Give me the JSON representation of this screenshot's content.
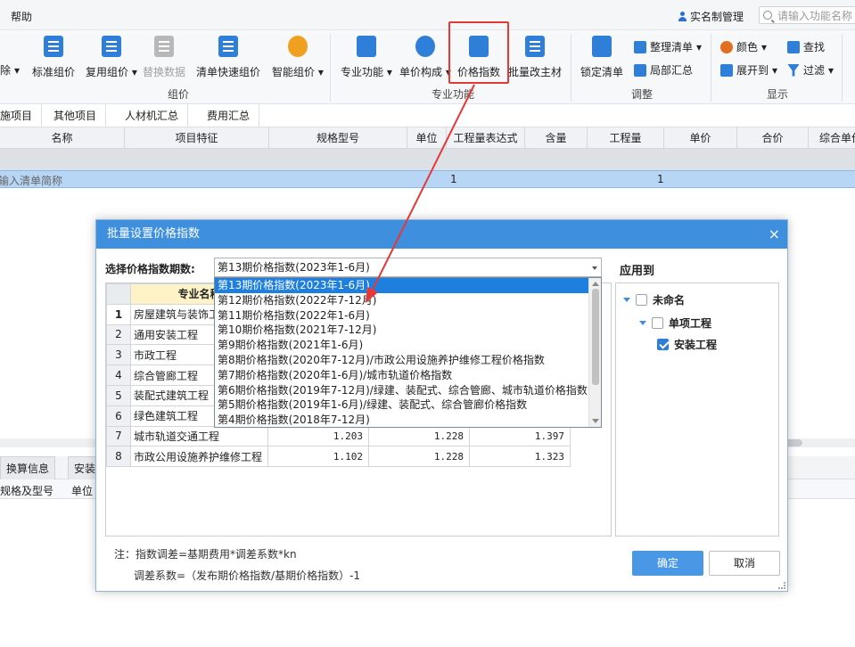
{
  "menubar": {
    "help": "帮助",
    "realname": "实名制管理",
    "search_placeholder": "请输入功能名称"
  },
  "ribbon": {
    "left_cut": "除",
    "buttons": [
      {
        "id": "standard",
        "label": "标准组价",
        "color": "#2f7fd8"
      },
      {
        "id": "reuse",
        "label": "复用组价",
        "color": "#2f7fd8"
      },
      {
        "id": "replace",
        "label": "替换数据",
        "color": "#b0b0b0"
      },
      {
        "id": "quick",
        "label": "清单快速组价",
        "color": "#2f7fd8"
      },
      {
        "id": "smart",
        "label": "智能组价",
        "color": "#f0a020"
      },
      {
        "id": "specialty",
        "label": "专业功能",
        "color": "#2f7fd8"
      },
      {
        "id": "unitprice",
        "label": "单价构成",
        "color": "#2f7fd8"
      },
      {
        "id": "priceindex",
        "label": "价格指数",
        "color": "#2f7fd8"
      },
      {
        "id": "batch",
        "label": "批量改主材",
        "color": "#2f7fd8"
      },
      {
        "id": "lock",
        "label": "锁定清单",
        "color": "#2f7fd8"
      }
    ],
    "small": {
      "organize": "整理清单",
      "local_summary": "局部汇总",
      "color": "颜色",
      "expand": "展开到",
      "find": "查找",
      "filter": "过滤"
    },
    "groups": {
      "pricing": "组价",
      "specialty": "专业功能",
      "adjust": "调整",
      "display": "显示"
    }
  },
  "tabs": [
    "施项目",
    "其他项目",
    "人材机汇总",
    "费用汇总"
  ],
  "grid": {
    "headers": [
      "名称",
      "项目特征",
      "规格型号",
      "单位",
      "工程量表达式",
      "含量",
      "工程量",
      "单价",
      "合价",
      "综合单价"
    ],
    "row": {
      "name": "输入清单简称",
      "expr": "1",
      "qty": "1"
    }
  },
  "bottom": {
    "tabs": [
      "换算信息",
      "安装"
    ],
    "headers": [
      "规格及型号",
      "单位"
    ]
  },
  "dialog": {
    "title": "批量设置价格指数",
    "close": "×",
    "period_label": "选择价格指数期数:",
    "period_selected": "第13期价格指数(2023年1-6月)",
    "period_options": [
      "第13期价格指数(2023年1-6月)",
      "第12期价格指数(2022年7-12月)",
      "第11期价格指数(2022年1-6月)",
      "第10期价格指数(2021年7-12月)",
      "第9期价格指数(2021年1-6月)",
      "第8期价格指数(2020年7-12月)/市政公用设施养护维修工程价格指数",
      "第7期价格指数(2020年1-6月)/城市轨道价格指数",
      "第6期价格指数(2019年7-12月)/绿建、装配式、综合管廊、城市轨道价格指数",
      "第5期价格指数(2019年1-6月)/绿建、装配式、综合管廊价格指数",
      "第4期价格指数(2018年7-12月)"
    ],
    "table": {
      "header": "专业名称",
      "rows": [
        {
          "no": "1",
          "name": "房屋建筑与装饰工程",
          "v1": "",
          "v2": "",
          "v3": ""
        },
        {
          "no": "2",
          "name": "通用安装工程",
          "v1": "",
          "v2": "",
          "v3": ""
        },
        {
          "no": "3",
          "name": "市政工程",
          "v1": "",
          "v2": "",
          "v3": ""
        },
        {
          "no": "4",
          "name": "综合管廊工程",
          "v1": "",
          "v2": "",
          "v3": ""
        },
        {
          "no": "5",
          "name": "装配式建筑工程",
          "v1": "",
          "v2": "",
          "v3": ""
        },
        {
          "no": "6",
          "name": "绿色建筑工程",
          "v1": "",
          "v2": "",
          "v3": ""
        },
        {
          "no": "7",
          "name": "城市轨道交通工程",
          "v1": "1.203",
          "v2": "1.228",
          "v3": "1.397"
        },
        {
          "no": "8",
          "name": "市政公用设施养护维修工程",
          "v1": "1.102",
          "v2": "1.228",
          "v3": "1.323"
        }
      ]
    },
    "apply": {
      "label": "应用到",
      "root": "未命名",
      "child": "单项工程",
      "leaf": "安装工程",
      "root_checked": false,
      "child_checked": false,
      "leaf_checked": true
    },
    "note1": "注：指数调差=基期费用*调差系数*kn",
    "note2": "调差系数=（发布期价格指数/基期价格指数）-1",
    "ok": "确定",
    "cancel": "取消"
  },
  "colors": {
    "accent": "#3f8fdf",
    "selection": "#1e7fde",
    "annotation": "#e53935"
  }
}
